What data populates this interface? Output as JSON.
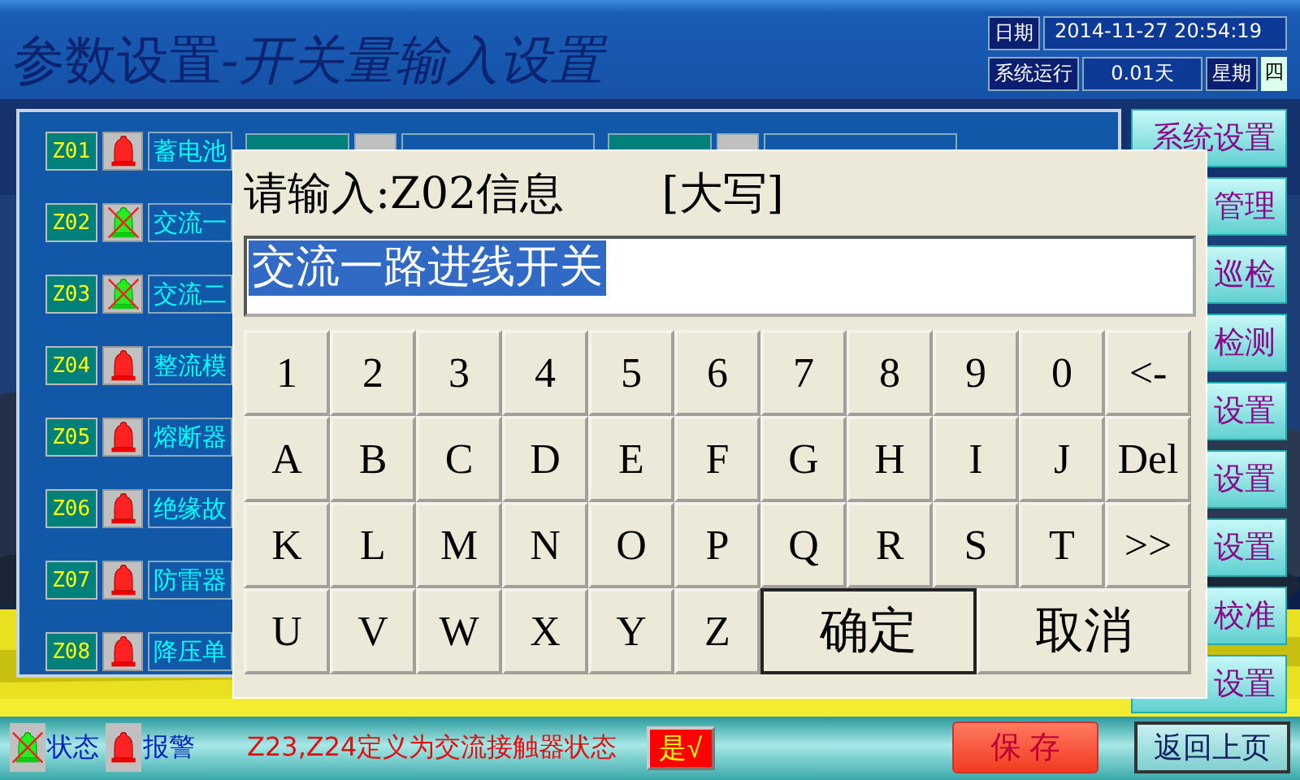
{
  "header": {
    "title": "参数设置",
    "subtitle": "-开关量输入设置",
    "date_label": "日期",
    "datetime": "2014-11-27 20:54:19",
    "runtime_label": "系统运行",
    "runtime": "0.01天",
    "weekday_label": "星期",
    "weekday": "四"
  },
  "inputs": [
    {
      "code": "Z01",
      "kind": "alarm",
      "name": "蓄电池"
    },
    {
      "code": "Z02",
      "kind": "disabled",
      "name": "交流一"
    },
    {
      "code": "Z03",
      "kind": "disabled",
      "name": "交流二"
    },
    {
      "code": "Z04",
      "kind": "alarm",
      "name": "整流模"
    },
    {
      "code": "Z05",
      "kind": "alarm",
      "name": "熔断器"
    },
    {
      "code": "Z06",
      "kind": "alarm",
      "name": "绝缘故"
    },
    {
      "code": "Z07",
      "kind": "alarm",
      "name": "防雷器"
    },
    {
      "code": "Z08",
      "kind": "alarm",
      "name": "降压单"
    }
  ],
  "side_menu": [
    "系统设置",
    "管理",
    "巡检",
    "检测",
    "设置",
    "设置",
    "设置",
    "校准",
    "设置"
  ],
  "dialog": {
    "prompt": "请输入:Z02信息",
    "mode": "[大写]",
    "value": "交流一路进线开关",
    "keys": [
      "1",
      "2",
      "3",
      "4",
      "5",
      "6",
      "7",
      "8",
      "9",
      "0",
      "<-",
      "A",
      "B",
      "C",
      "D",
      "E",
      "F",
      "G",
      "H",
      "I",
      "J",
      "Del",
      "K",
      "L",
      "M",
      "N",
      "O",
      "P",
      "Q",
      "R",
      "S",
      "T",
      ">>",
      "U",
      "V",
      "W",
      "X",
      "Y",
      "Z"
    ],
    "actions": [
      {
        "label": "确定",
        "kind": "confirm"
      },
      {
        "label": "取消",
        "kind": "cancel"
      }
    ]
  },
  "footer": {
    "legend": [
      {
        "kind": "disabled",
        "label": "状态"
      },
      {
        "kind": "alarm",
        "label": "报警"
      }
    ],
    "note": "Z23,Z24定义为交流接触器状态",
    "toggle": {
      "label": "是√",
      "on": true
    },
    "save": "保 存",
    "back": "返回上页"
  }
}
